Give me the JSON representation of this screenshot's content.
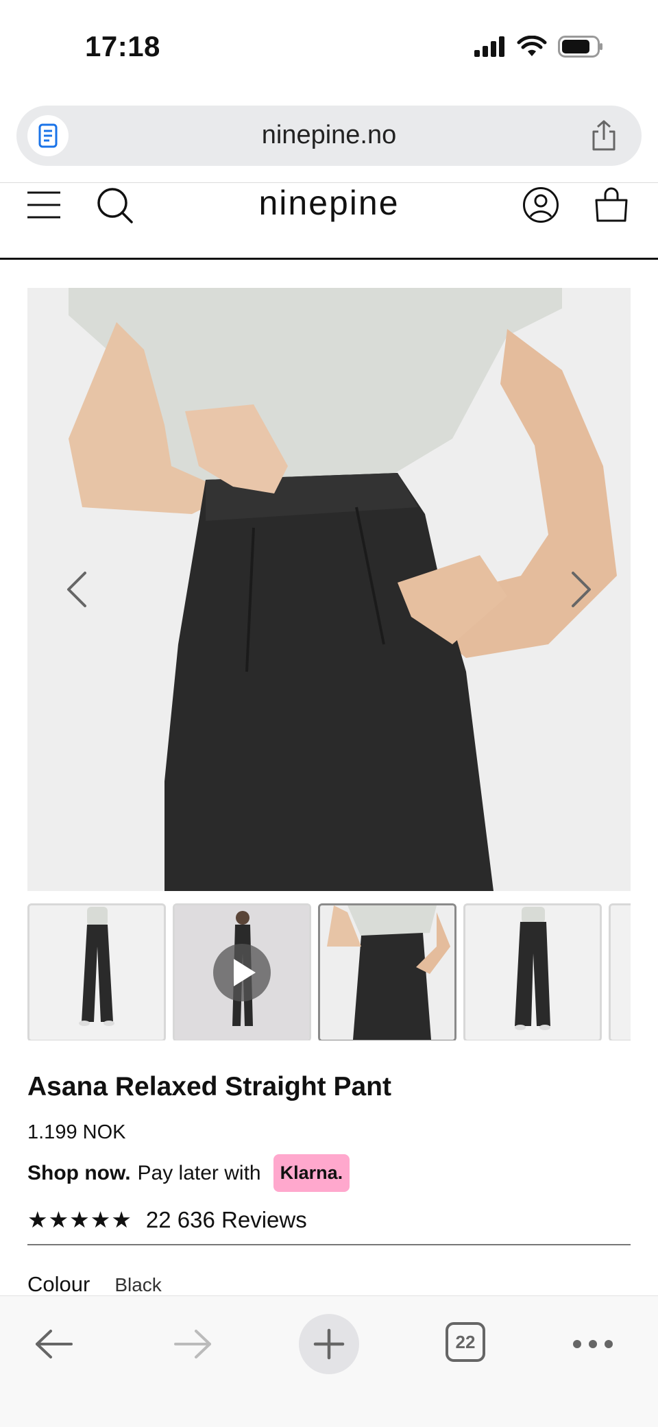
{
  "status_bar": {
    "time": "17:18",
    "icons": [
      "signal-icon",
      "wifi-icon",
      "battery-icon"
    ]
  },
  "browser": {
    "url": "ninepine.no",
    "icons": [
      "reader-icon",
      "share-icon"
    ],
    "toolbar": {
      "tab_count": "22",
      "icons": [
        "back-arrow-icon",
        "forward-arrow-icon",
        "new-tab-plus-icon",
        "tabs-icon",
        "more-icon"
      ]
    }
  },
  "header": {
    "logo": "ninepine",
    "icons": [
      "menu-icon",
      "search-icon",
      "account-icon",
      "bag-icon"
    ]
  },
  "gallery": {
    "icons": [
      "chevron-left-icon",
      "chevron-right-icon",
      "play-icon"
    ],
    "thumbnail_count": 5,
    "active_index": 2
  },
  "product": {
    "title": "Asana Relaxed Straight Pant",
    "price": "1.199 NOK",
    "klarna": {
      "shop_now": "Shop now.",
      "pay_later": "Pay later with",
      "badge": "Klarna."
    },
    "stars": "★★★★★",
    "rating": 5,
    "reviews": "22 636 Reviews",
    "colour_label": "Colour",
    "colour_value": "Black"
  },
  "colors": {
    "accent_klarna": "#ffa8cd",
    "pants": "#2a2a2a",
    "top": "#d9dcd7",
    "urlbar_bg": "#e9eaec"
  }
}
